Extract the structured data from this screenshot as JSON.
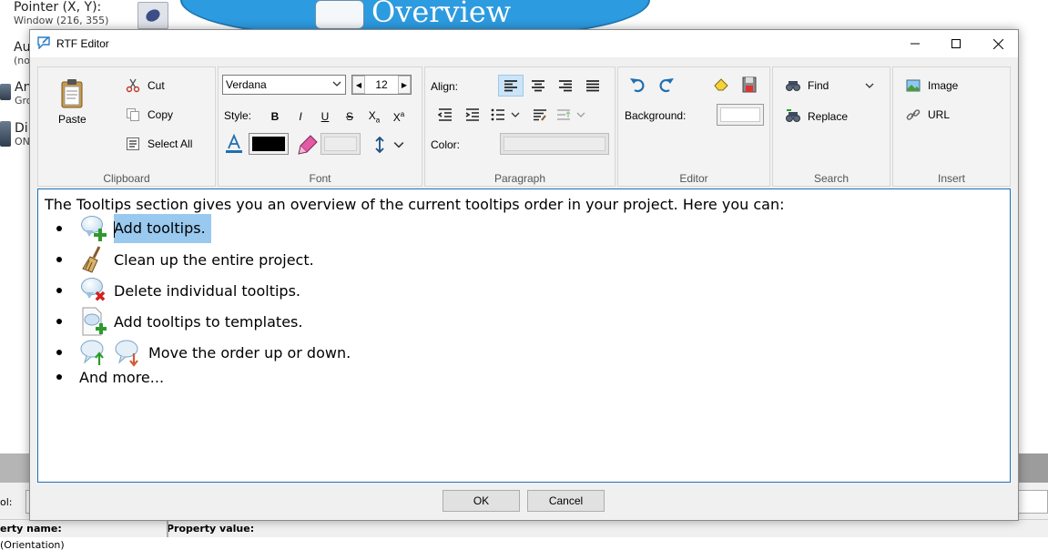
{
  "background": {
    "pointer_label": "Pointer (X, Y):",
    "pointer_value": "Window (216, 355)",
    "row2_label": "Au",
    "row2_sub": "(no",
    "row3_label": "An",
    "row3_sub": "Gro",
    "row4_label": "Di",
    "row4_sub": "ON",
    "overview_title": "Overview",
    "toolbar_label": "ol:",
    "property_name_header": "erty name:",
    "property_value_header": "Property value:",
    "property_row": "(Orientation)"
  },
  "dialog": {
    "title": "RTF Editor"
  },
  "ribbon": {
    "clipboard": {
      "label": "Clipboard",
      "paste": "Paste",
      "cut": "Cut",
      "copy": "Copy",
      "select_all": "Select All"
    },
    "font": {
      "label": "Font",
      "family": "Verdana",
      "size": "12",
      "style_label": "Style:",
      "bold": "B",
      "italic": "I",
      "underline": "U",
      "strike": "S",
      "subscript": "Xa",
      "superscript": "Xa",
      "font_color": "#000000"
    },
    "paragraph": {
      "label": "Paragraph",
      "align_label": "Align:",
      "color_label": "Color:"
    },
    "editor": {
      "label": "Editor",
      "background_label": "Background:",
      "background_color": "#ffffff"
    },
    "search": {
      "label": "Search",
      "find": "Find",
      "replace": "Replace"
    },
    "insert": {
      "label": "Insert",
      "image": "Image",
      "url": "URL"
    }
  },
  "content": {
    "intro": "The Tooltips section gives you an overview of the current tooltips order in your project. Here you can:",
    "bullets": [
      {
        "text": "Add tooltips.",
        "icon": "add-tooltip-icon"
      },
      {
        "text": "Clean up the entire project.",
        "icon": "broom-icon"
      },
      {
        "text": "Delete individual tooltips.",
        "icon": "delete-tooltip-icon"
      },
      {
        "text": "Add tooltips to templates.",
        "icon": "add-to-template-icon"
      },
      {
        "text": "Move the order up or down.",
        "icon": "move-up-down-icon"
      },
      {
        "text": "And more..."
      }
    ]
  },
  "buttons": {
    "ok": "OK",
    "cancel": "Cancel"
  }
}
